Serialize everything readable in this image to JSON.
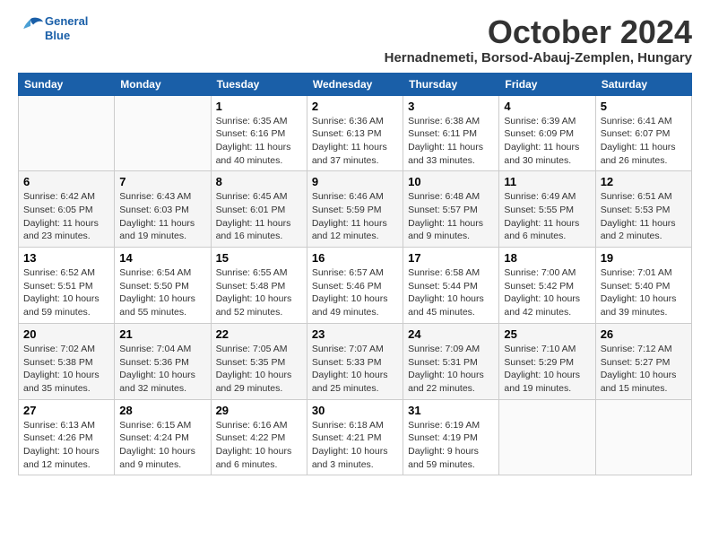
{
  "header": {
    "logo_line1": "General",
    "logo_line2": "Blue",
    "title": "October 2024",
    "location": "Hernadnemeti, Borsod-Abauj-Zemplen, Hungary"
  },
  "weekdays": [
    "Sunday",
    "Monday",
    "Tuesday",
    "Wednesday",
    "Thursday",
    "Friday",
    "Saturday"
  ],
  "weeks": [
    [
      {
        "day": "",
        "sunrise": "",
        "sunset": "",
        "daylight": ""
      },
      {
        "day": "",
        "sunrise": "",
        "sunset": "",
        "daylight": ""
      },
      {
        "day": "1",
        "sunrise": "Sunrise: 6:35 AM",
        "sunset": "Sunset: 6:16 PM",
        "daylight": "Daylight: 11 hours and 40 minutes."
      },
      {
        "day": "2",
        "sunrise": "Sunrise: 6:36 AM",
        "sunset": "Sunset: 6:13 PM",
        "daylight": "Daylight: 11 hours and 37 minutes."
      },
      {
        "day": "3",
        "sunrise": "Sunrise: 6:38 AM",
        "sunset": "Sunset: 6:11 PM",
        "daylight": "Daylight: 11 hours and 33 minutes."
      },
      {
        "day": "4",
        "sunrise": "Sunrise: 6:39 AM",
        "sunset": "Sunset: 6:09 PM",
        "daylight": "Daylight: 11 hours and 30 minutes."
      },
      {
        "day": "5",
        "sunrise": "Sunrise: 6:41 AM",
        "sunset": "Sunset: 6:07 PM",
        "daylight": "Daylight: 11 hours and 26 minutes."
      }
    ],
    [
      {
        "day": "6",
        "sunrise": "Sunrise: 6:42 AM",
        "sunset": "Sunset: 6:05 PM",
        "daylight": "Daylight: 11 hours and 23 minutes."
      },
      {
        "day": "7",
        "sunrise": "Sunrise: 6:43 AM",
        "sunset": "Sunset: 6:03 PM",
        "daylight": "Daylight: 11 hours and 19 minutes."
      },
      {
        "day": "8",
        "sunrise": "Sunrise: 6:45 AM",
        "sunset": "Sunset: 6:01 PM",
        "daylight": "Daylight: 11 hours and 16 minutes."
      },
      {
        "day": "9",
        "sunrise": "Sunrise: 6:46 AM",
        "sunset": "Sunset: 5:59 PM",
        "daylight": "Daylight: 11 hours and 12 minutes."
      },
      {
        "day": "10",
        "sunrise": "Sunrise: 6:48 AM",
        "sunset": "Sunset: 5:57 PM",
        "daylight": "Daylight: 11 hours and 9 minutes."
      },
      {
        "day": "11",
        "sunrise": "Sunrise: 6:49 AM",
        "sunset": "Sunset: 5:55 PM",
        "daylight": "Daylight: 11 hours and 6 minutes."
      },
      {
        "day": "12",
        "sunrise": "Sunrise: 6:51 AM",
        "sunset": "Sunset: 5:53 PM",
        "daylight": "Daylight: 11 hours and 2 minutes."
      }
    ],
    [
      {
        "day": "13",
        "sunrise": "Sunrise: 6:52 AM",
        "sunset": "Sunset: 5:51 PM",
        "daylight": "Daylight: 10 hours and 59 minutes."
      },
      {
        "day": "14",
        "sunrise": "Sunrise: 6:54 AM",
        "sunset": "Sunset: 5:50 PM",
        "daylight": "Daylight: 10 hours and 55 minutes."
      },
      {
        "day": "15",
        "sunrise": "Sunrise: 6:55 AM",
        "sunset": "Sunset: 5:48 PM",
        "daylight": "Daylight: 10 hours and 52 minutes."
      },
      {
        "day": "16",
        "sunrise": "Sunrise: 6:57 AM",
        "sunset": "Sunset: 5:46 PM",
        "daylight": "Daylight: 10 hours and 49 minutes."
      },
      {
        "day": "17",
        "sunrise": "Sunrise: 6:58 AM",
        "sunset": "Sunset: 5:44 PM",
        "daylight": "Daylight: 10 hours and 45 minutes."
      },
      {
        "day": "18",
        "sunrise": "Sunrise: 7:00 AM",
        "sunset": "Sunset: 5:42 PM",
        "daylight": "Daylight: 10 hours and 42 minutes."
      },
      {
        "day": "19",
        "sunrise": "Sunrise: 7:01 AM",
        "sunset": "Sunset: 5:40 PM",
        "daylight": "Daylight: 10 hours and 39 minutes."
      }
    ],
    [
      {
        "day": "20",
        "sunrise": "Sunrise: 7:02 AM",
        "sunset": "Sunset: 5:38 PM",
        "daylight": "Daylight: 10 hours and 35 minutes."
      },
      {
        "day": "21",
        "sunrise": "Sunrise: 7:04 AM",
        "sunset": "Sunset: 5:36 PM",
        "daylight": "Daylight: 10 hours and 32 minutes."
      },
      {
        "day": "22",
        "sunrise": "Sunrise: 7:05 AM",
        "sunset": "Sunset: 5:35 PM",
        "daylight": "Daylight: 10 hours and 29 minutes."
      },
      {
        "day": "23",
        "sunrise": "Sunrise: 7:07 AM",
        "sunset": "Sunset: 5:33 PM",
        "daylight": "Daylight: 10 hours and 25 minutes."
      },
      {
        "day": "24",
        "sunrise": "Sunrise: 7:09 AM",
        "sunset": "Sunset: 5:31 PM",
        "daylight": "Daylight: 10 hours and 22 minutes."
      },
      {
        "day": "25",
        "sunrise": "Sunrise: 7:10 AM",
        "sunset": "Sunset: 5:29 PM",
        "daylight": "Daylight: 10 hours and 19 minutes."
      },
      {
        "day": "26",
        "sunrise": "Sunrise: 7:12 AM",
        "sunset": "Sunset: 5:27 PM",
        "daylight": "Daylight: 10 hours and 15 minutes."
      }
    ],
    [
      {
        "day": "27",
        "sunrise": "Sunrise: 6:13 AM",
        "sunset": "Sunset: 4:26 PM",
        "daylight": "Daylight: 10 hours and 12 minutes."
      },
      {
        "day": "28",
        "sunrise": "Sunrise: 6:15 AM",
        "sunset": "Sunset: 4:24 PM",
        "daylight": "Daylight: 10 hours and 9 minutes."
      },
      {
        "day": "29",
        "sunrise": "Sunrise: 6:16 AM",
        "sunset": "Sunset: 4:22 PM",
        "daylight": "Daylight: 10 hours and 6 minutes."
      },
      {
        "day": "30",
        "sunrise": "Sunrise: 6:18 AM",
        "sunset": "Sunset: 4:21 PM",
        "daylight": "Daylight: 10 hours and 3 minutes."
      },
      {
        "day": "31",
        "sunrise": "Sunrise: 6:19 AM",
        "sunset": "Sunset: 4:19 PM",
        "daylight": "Daylight: 9 hours and 59 minutes."
      },
      {
        "day": "",
        "sunrise": "",
        "sunset": "",
        "daylight": ""
      },
      {
        "day": "",
        "sunrise": "",
        "sunset": "",
        "daylight": ""
      }
    ]
  ]
}
